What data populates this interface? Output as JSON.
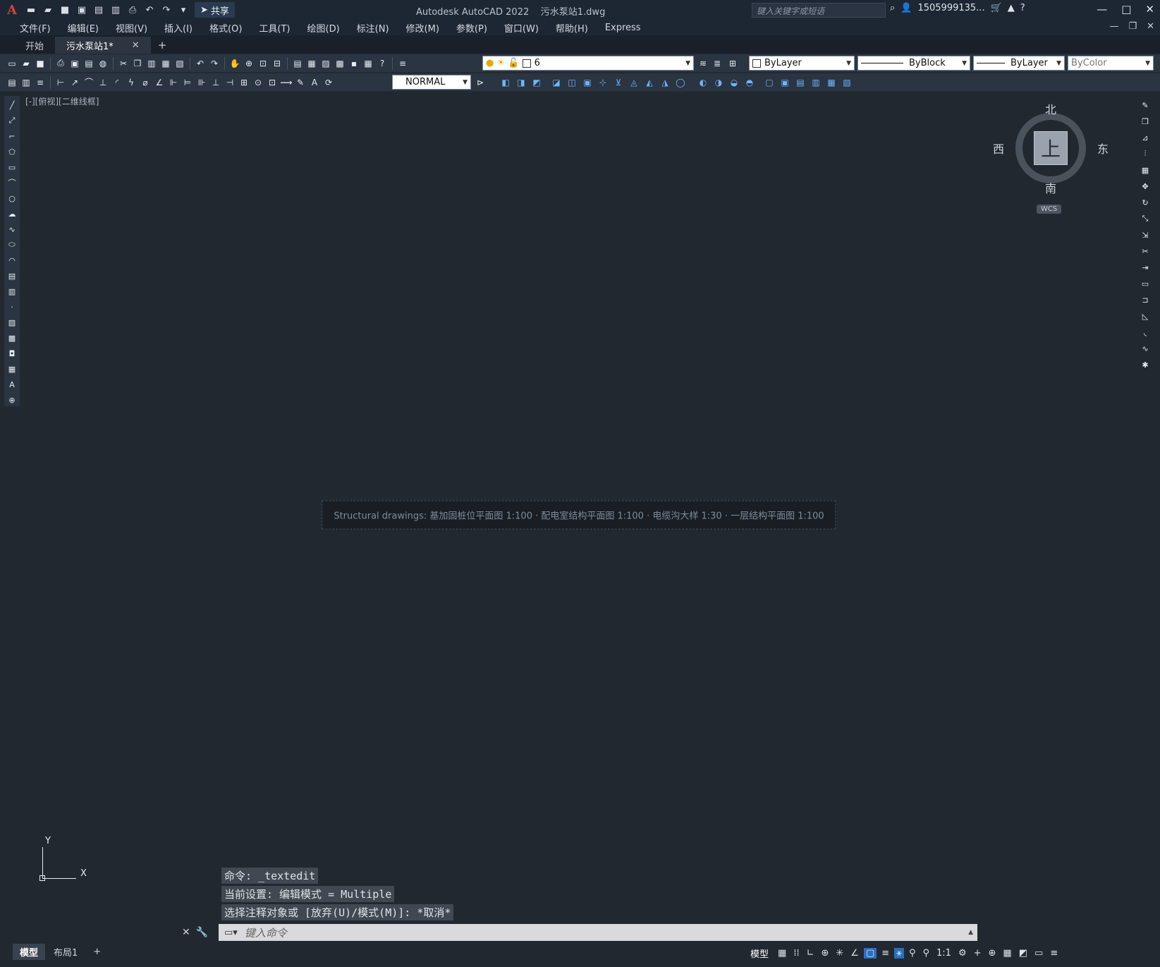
{
  "window": {
    "app_title": "Autodesk AutoCAD 2022",
    "file_title": "污水泵站1.dwg",
    "share_label": "共享",
    "search_placeholder": "键入关键字或短语",
    "user_name": "1505999135...",
    "controls": [
      "—",
      "□",
      "✕"
    ]
  },
  "menu": [
    "文件(F)",
    "编辑(E)",
    "视图(V)",
    "插入(I)",
    "格式(O)",
    "工具(T)",
    "绘图(D)",
    "标注(N)",
    "修改(M)",
    "参数(P)",
    "窗口(W)",
    "帮助(H)",
    "Express"
  ],
  "doc_tabs": [
    {
      "label": "开始",
      "active": false
    },
    {
      "label": "污水泵站1*",
      "active": true
    }
  ],
  "toolbar": {
    "layer_value": "6",
    "color_value": "ByLayer",
    "linetype_value": "ByBlock",
    "lineweight_value": "ByLayer",
    "plotstyle_value": "ByColor",
    "textstyle_value": "NORMAL"
  },
  "canvas": {
    "view_label": "[-][俯视][二维线框]",
    "placeholder_note": "Structural drawings: 基加固桩位平面图 1:100 · 配电室结构平面图 1:100 · 电缆沟大样 1:30 · 一层结构平面图 1:100"
  },
  "viewcube": {
    "north": "北",
    "south": "南",
    "west": "西",
    "east": "东",
    "face": "上",
    "wcs": "WCS"
  },
  "ucs": {
    "x": "X",
    "y": "Y"
  },
  "command_history": [
    "命令: _textedit",
    "当前设置: 编辑模式 = Multiple",
    "选择注释对象或 [放弃(U)/模式(M)]: *取消*"
  ],
  "command_placeholder": "键入命令",
  "layout_tabs": [
    {
      "label": "模型",
      "active": true
    },
    {
      "label": "布局1",
      "active": false
    },
    {
      "label": "+",
      "active": false
    }
  ],
  "status": {
    "model_label": "模型",
    "scale": "1:1"
  },
  "colors": {
    "canvas_bg": "#212830",
    "chrome_bg": "#1d2734",
    "toolbar_bg": "#2b3441",
    "accent": "#2a6fbe"
  }
}
